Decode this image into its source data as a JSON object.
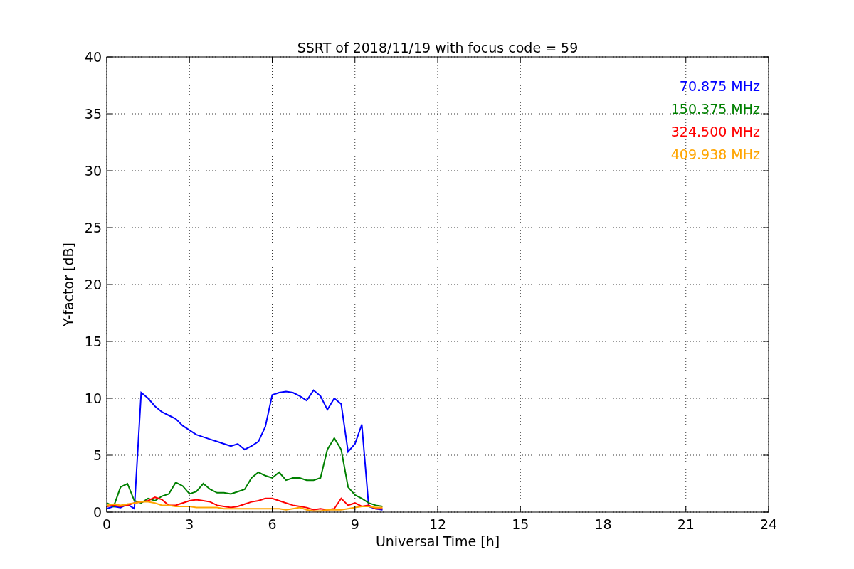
{
  "chart_data": {
    "type": "line",
    "title": "SSRT of 2018/11/19 with focus code = 59",
    "xlabel": "Universal Time [h]",
    "ylabel": "Y-factor [dB]",
    "x": [
      0,
      0.25,
      0.5,
      0.75,
      1,
      1.25,
      1.5,
      1.75,
      2,
      2.25,
      2.5,
      2.75,
      3,
      3.25,
      3.5,
      3.75,
      4,
      4.25,
      4.5,
      4.75,
      5,
      5.25,
      5.5,
      5.75,
      6,
      6.25,
      6.5,
      6.75,
      7,
      7.25,
      7.5,
      7.75,
      8,
      8.25,
      8.5,
      8.75,
      9,
      9.25,
      9.5,
      9.75,
      10
    ],
    "series": [
      {
        "name": "70.875 MHz",
        "color": "#0000ff",
        "values": [
          0.3,
          0.5,
          0.4,
          0.7,
          0.3,
          10.5,
          10,
          9.3,
          8.8,
          8.5,
          8.2,
          7.6,
          7.2,
          6.8,
          6.6,
          6.4,
          6.2,
          6,
          5.8,
          6,
          5.5,
          5.8,
          6.2,
          7.5,
          10.3,
          10.5,
          10.6,
          10.5,
          10.2,
          9.8,
          10.7,
          10.2,
          9,
          10,
          9.5,
          5.3,
          6,
          7.7,
          0.5,
          0.3,
          0.2
        ]
      },
      {
        "name": "150.375 MHz",
        "color": "#008000",
        "values": [
          0.8,
          0.5,
          2.2,
          2.5,
          1,
          0.8,
          1.2,
          1,
          1.4,
          1.6,
          2.6,
          2.3,
          1.6,
          1.8,
          2.5,
          2,
          1.7,
          1.7,
          1.6,
          1.8,
          2,
          3,
          3.5,
          3.2,
          3,
          3.5,
          2.8,
          3,
          3,
          2.8,
          2.8,
          3,
          5.5,
          6.5,
          5.5,
          2.2,
          1.5,
          1.2,
          0.8,
          0.6,
          0.5
        ]
      },
      {
        "name": "324.500 MHz",
        "color": "#ff0000",
        "values": [
          0.5,
          0.6,
          0.5,
          0.6,
          0.8,
          0.9,
          1,
          1.3,
          1.1,
          0.6,
          0.6,
          0.8,
          1,
          1.1,
          1,
          0.9,
          0.6,
          0.5,
          0.4,
          0.5,
          0.7,
          0.9,
          1,
          1.2,
          1.2,
          1,
          0.8,
          0.6,
          0.5,
          0.4,
          0.2,
          0.3,
          0.2,
          0.3,
          1.2,
          0.6,
          0.8,
          0.5,
          0.6,
          0.3,
          0.3
        ]
      },
      {
        "name": "409.938 MHz",
        "color": "#ffa500",
        "values": [
          0.6,
          0.7,
          0.6,
          0.7,
          0.8,
          0.9,
          0.9,
          0.8,
          0.6,
          0.6,
          0.5,
          0.5,
          0.5,
          0.4,
          0.4,
          0.4,
          0.4,
          0.3,
          0.3,
          0.3,
          0.3,
          0.3,
          0.3,
          0.3,
          0.3,
          0.3,
          0.2,
          0.3,
          0.4,
          0.2,
          0.1,
          0.1,
          0.2,
          0.2,
          0.2,
          0.3,
          0.4,
          0.5,
          0.5,
          0.4,
          0.4
        ]
      }
    ],
    "grid": true,
    "xlim": [
      0,
      24
    ],
    "ylim": [
      0,
      40
    ],
    "xticks": [
      0,
      3,
      6,
      9,
      12,
      15,
      18,
      21,
      24
    ],
    "yticks": [
      0,
      5,
      10,
      15,
      20,
      25,
      30,
      35,
      40
    ]
  }
}
